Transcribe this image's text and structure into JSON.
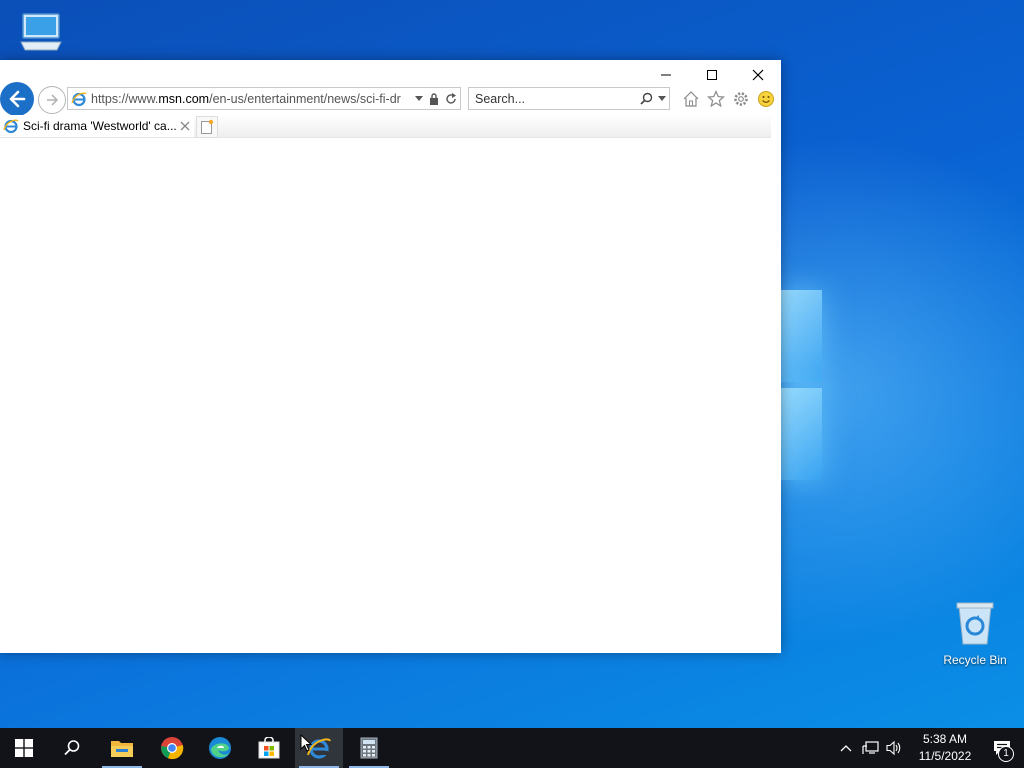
{
  "desktop": {
    "icons": [
      {
        "name": "this-pc-icon",
        "label": ""
      },
      {
        "name": "recycle-bin-icon",
        "label": "Recycle Bin"
      }
    ]
  },
  "browser": {
    "address": {
      "prefix": "https://www.",
      "host": "msn.com",
      "path": "/en-us/entertainment/news/sci-fi-dr"
    },
    "search": {
      "placeholder": "Search..."
    },
    "tab": {
      "title": "Sci-fi drama 'Westworld' ca..."
    }
  },
  "taskbar": {
    "apps": [
      "start",
      "search",
      "file-explorer",
      "chrome",
      "edge",
      "store",
      "internet-explorer",
      "calculator"
    ],
    "active_app": "internet-explorer",
    "clock": {
      "time": "5:38 AM",
      "date": "11/5/2022"
    },
    "notification_count": "1"
  },
  "colors": {
    "ie_blue": "#1c6fc7",
    "taskbar": "#111318",
    "desktop_blue": "#0a62d2"
  }
}
